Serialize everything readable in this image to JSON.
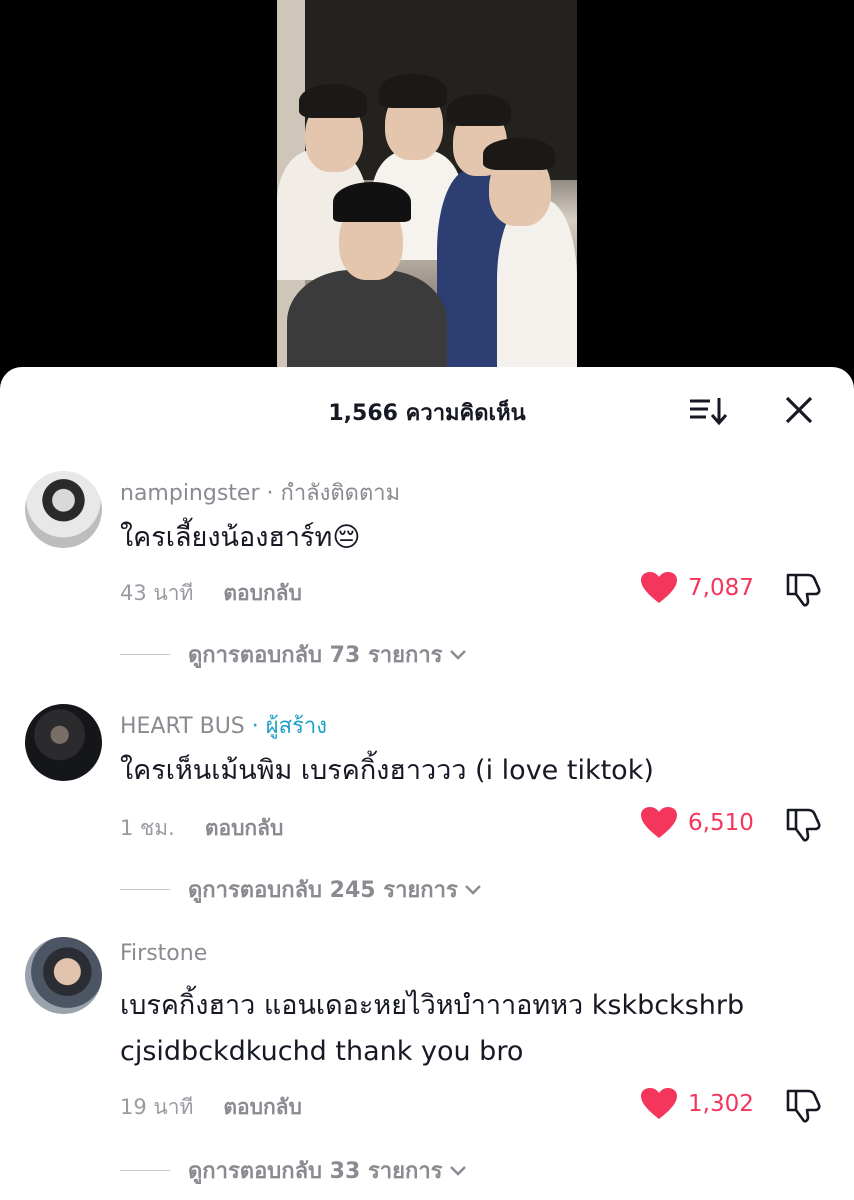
{
  "header": {
    "title": "1,566 ความคิดเห็น"
  },
  "comments": [
    {
      "username": "nampingster",
      "separator": " · ",
      "tag": "กำลังติดตาม",
      "text": "ใครเลี้ยงน้องฮาร์ท😔",
      "time": "43 นาที",
      "reply_label": "ตอบกลับ",
      "likes": "7,087",
      "view_replies": "ดูการตอบกลับ 73 รายการ"
    },
    {
      "username": "HEART BUS",
      "separator": " · ",
      "tag": "ผู้สร้าง",
      "text": "ใครเห็นเม้นพิม เบรคกิ้งฮาววว (i love tiktok)",
      "time": "1 ชม.",
      "reply_label": "ตอบกลับ",
      "likes": "6,510",
      "view_replies": "ดูการตอบกลับ 245 รายการ"
    },
    {
      "username": "Firstone",
      "separator": "",
      "tag": "",
      "text": "เบรคกิ้งฮาว แอนเดอะหยไวิหบำาาอทหว kskbckshrb cjsidbckdkuchd thank you bro",
      "time": "19 นาที",
      "reply_label": "ตอบกลับ",
      "likes": "1,302",
      "view_replies": "ดูการตอบกลับ 33 รายการ"
    }
  ],
  "colors": {
    "like_red": "#f4355c",
    "creator_blue": "#20a0c8",
    "muted_gray": "#8a8b91"
  },
  "icons": [
    "sort-icon",
    "close-icon",
    "heart-icon",
    "dislike-icon",
    "chevron-down-icon"
  ]
}
